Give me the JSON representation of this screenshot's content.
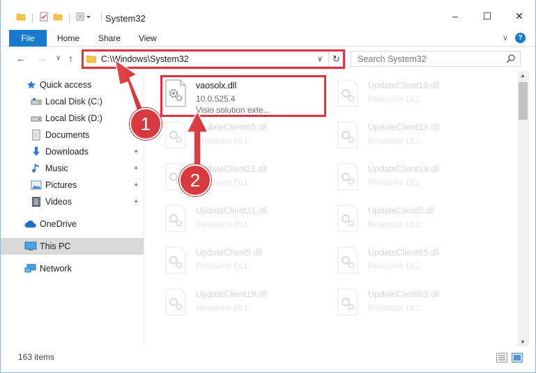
{
  "window": {
    "title": "System32",
    "controls": {
      "minimize": "–",
      "maximize": "☐",
      "close": "✕"
    }
  },
  "ribbon": {
    "file": "File",
    "tabs": [
      "Home",
      "Share",
      "View"
    ],
    "collapse": "∨",
    "help": "?"
  },
  "nav": {
    "back": "←",
    "forward": "→",
    "recent": "∨",
    "up": "↑",
    "address": "C:\\Windows\\System32",
    "address_chevron": "∨",
    "refresh": "↻",
    "search_placeholder": "Search System32"
  },
  "sidebar": {
    "items": [
      {
        "label": "Quick access",
        "icon": "star-icon",
        "pinned": false
      },
      {
        "label": "Local Disk (C:)",
        "icon": "drive-icon",
        "pinned": false
      },
      {
        "label": "Local Disk (D:)",
        "icon": "drive-icon",
        "pinned": false
      },
      {
        "label": "Documents",
        "icon": "documents-icon",
        "pinned": true
      },
      {
        "label": "Downloads",
        "icon": "downloads-icon",
        "pinned": true
      },
      {
        "label": "Music",
        "icon": "music-icon",
        "pinned": true
      },
      {
        "label": "Pictures",
        "icon": "pictures-icon",
        "pinned": true
      },
      {
        "label": "Videos",
        "icon": "videos-icon",
        "pinned": true
      },
      {
        "label": "OneDrive",
        "icon": "cloud-icon",
        "pinned": false
      },
      {
        "label": "This PC",
        "icon": "pc-icon",
        "pinned": false,
        "selected": true
      },
      {
        "label": "Network",
        "icon": "network-icon",
        "pinned": false
      }
    ],
    "pin_glyph": "📌"
  },
  "files": {
    "left": [
      {
        "name": "vaosolx.dll",
        "line2": "10.0.525.4",
        "line3": "Visio solution exte...",
        "highlighted": true
      },
      {
        "name": "UpdateClient65.dll",
        "line2": "Resource DLL"
      },
      {
        "name": "UpdateClient21.dll",
        "line2": "Resource DLL"
      },
      {
        "name": "UpdateClient21.dll",
        "line2": "Resource DLL"
      },
      {
        "name": "UpdateClient5.dll",
        "line2": "Resource DLL"
      },
      {
        "name": "UpdateClient19.dll",
        "line2": "Resource DLL"
      }
    ],
    "right": [
      {
        "name": "UpdateClient19.dll",
        "line2": "Resource DLL"
      },
      {
        "name": "UpdateClient19.dll",
        "line2": "Resource DLL"
      },
      {
        "name": "UpdateClient19.dll",
        "line2": "Resource DLL"
      },
      {
        "name": "UpdateClient5.dll",
        "line2": "Resource DLL"
      },
      {
        "name": "UpdateClient65.dll",
        "line2": "Resource DLL"
      },
      {
        "name": "UpdateClient63.dll",
        "line2": "Resource DLL"
      }
    ]
  },
  "status": {
    "item_count": "163 items"
  },
  "callouts": [
    "1",
    "2"
  ],
  "colors": {
    "accent": "#1979ca",
    "annotation_red": "#e0323b",
    "callout_red": "#d63a3f",
    "selected_bg": "#d9d9d9"
  }
}
